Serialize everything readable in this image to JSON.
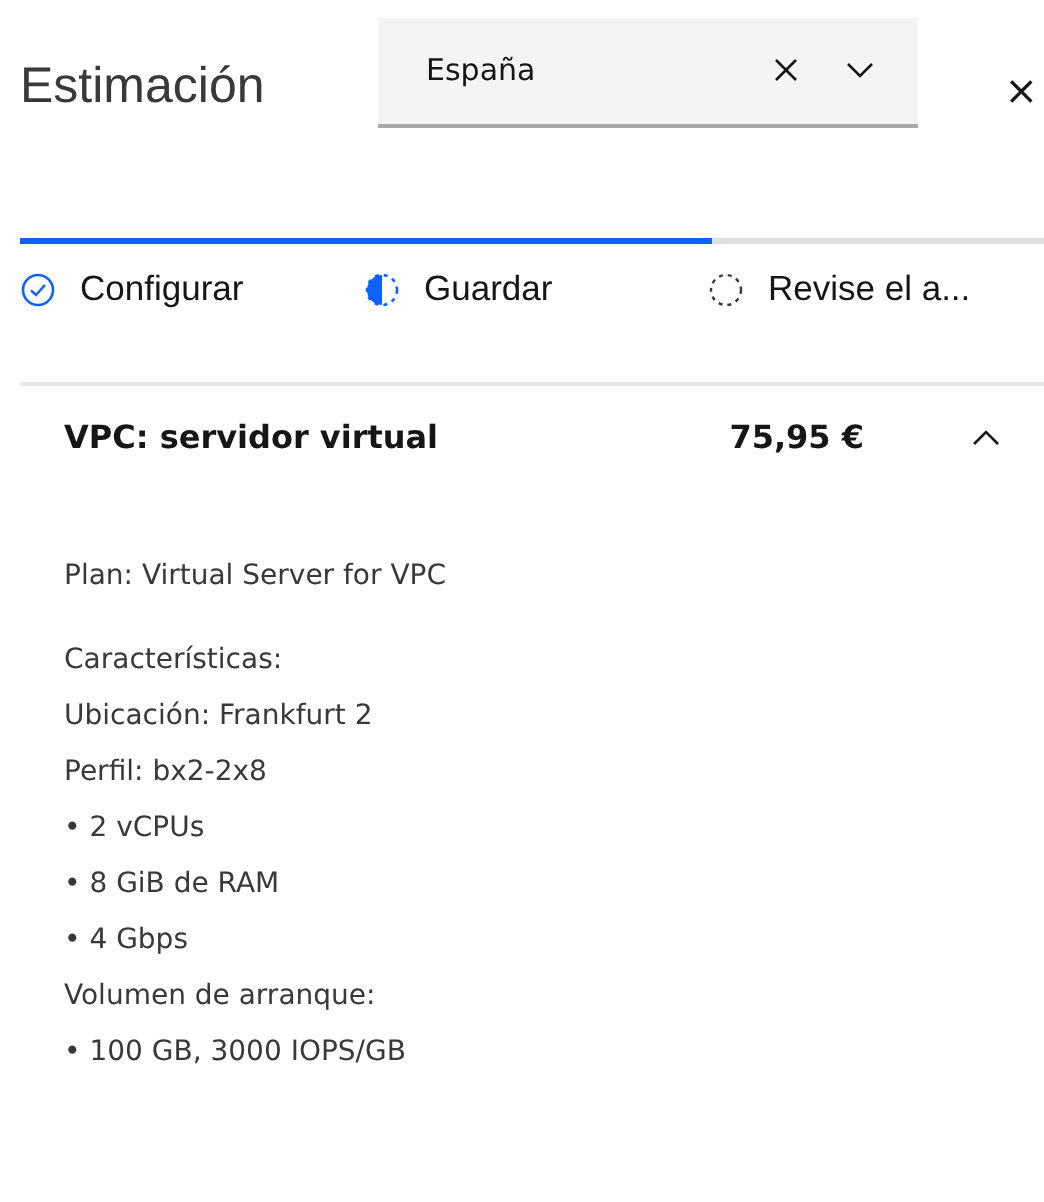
{
  "header": {
    "title": "Estimación",
    "country_select": {
      "value": "España"
    },
    "close_label": "×"
  },
  "progress": {
    "level": 0.675,
    "steps": [
      {
        "label": "Configurar",
        "kind": "complete"
      },
      {
        "label": "Guardar",
        "kind": "current"
      },
      {
        "label": "Revise el a...",
        "kind": "pending"
      }
    ]
  },
  "item": {
    "name": "VPC: servidor virtual",
    "price": "75,95 €",
    "expanded": true,
    "plan": "Plan: Virtual Server for VPC",
    "details": [
      "Características:",
      "Ubicación: Frankfurt 2",
      "Perfil: bx2-2x8",
      "• 2 vCPUs",
      "• 8 GiB de RAM",
      "• 4 Gbps",
      "Volumen de arranque:",
      "• 100 GB, 3000 IOPS/GB"
    ]
  }
}
